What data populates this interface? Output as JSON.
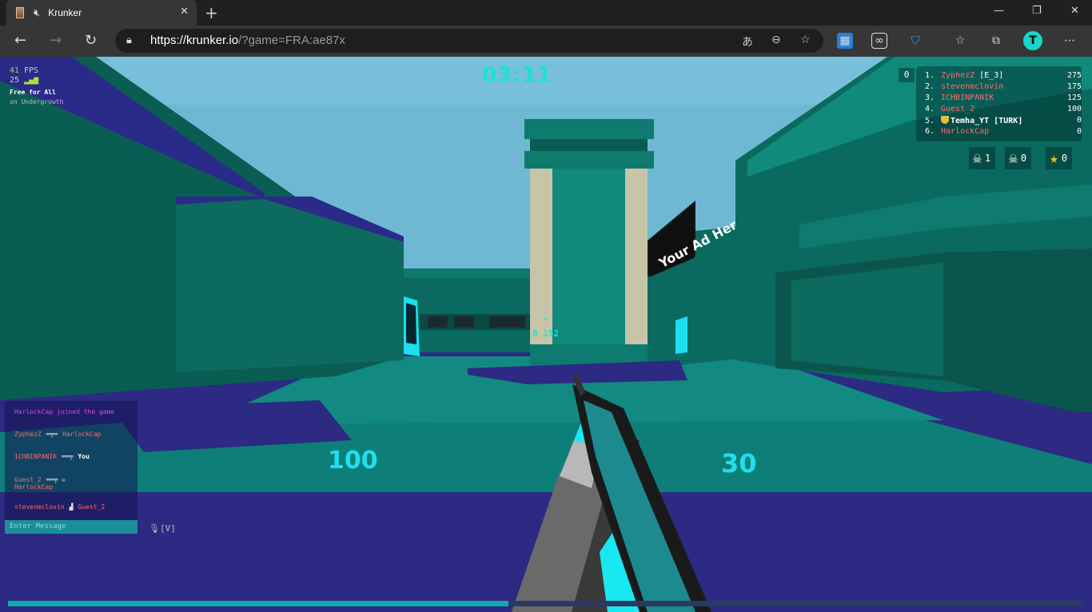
{
  "browser": {
    "tab_title": "Krunker",
    "url_host": "https://krunker.io",
    "url_path": "/?game=FRA:ae87x",
    "avatar_letter": "T"
  },
  "hud": {
    "fps_value": "41",
    "fps_label": "FPS",
    "ping_value": "25",
    "mode": "Free for All",
    "map": "on Undergrowth",
    "timer": "03:11",
    "health": "100",
    "ammo": "30",
    "crosshair_text": "0 152",
    "my_score": "0",
    "xp_progress": 0.465
  },
  "leaderboard": [
    {
      "rank": "1.",
      "name": "ZyphezZ",
      "clan": "[E_3]",
      "score": "275"
    },
    {
      "rank": "2.",
      "name": "stevenmclovin",
      "clan": "",
      "score": "175"
    },
    {
      "rank": "3.",
      "name": "ICHBINPANIK",
      "clan": "",
      "score": "125"
    },
    {
      "rank": "4.",
      "name": "Guest_2",
      "clan": "",
      "score": "100"
    },
    {
      "rank": "5.",
      "name": "Temha_YT [TURK]",
      "clan": "",
      "score": "0",
      "me": true
    },
    {
      "rank": "6.",
      "name": "HarlockCap",
      "clan": "",
      "score": "0"
    }
  ],
  "killstats": {
    "kills": "1",
    "deaths": "0",
    "streak": "0"
  },
  "chat": {
    "join": "HarlockCap joined the game",
    "feed": [
      {
        "killer": "ZyphezZ",
        "victim": "HarlockCap"
      },
      {
        "killer": "ICHBINPANIK",
        "victim": "You"
      },
      {
        "killer": "Guest_2",
        "victim": "HarlockCap"
      },
      {
        "killer": "stevenmclovin",
        "victim": "Guest_2"
      }
    ],
    "placeholder": "Enter Message",
    "voice_key": "[V]"
  },
  "scene": {
    "billboard": "Your Ad Here"
  },
  "colors": {
    "sky": "#6fb8d4",
    "wall_teal": "#0b6a5e",
    "floor_navy": "#2c2a82",
    "accent_cyan": "#1ee0ee"
  }
}
